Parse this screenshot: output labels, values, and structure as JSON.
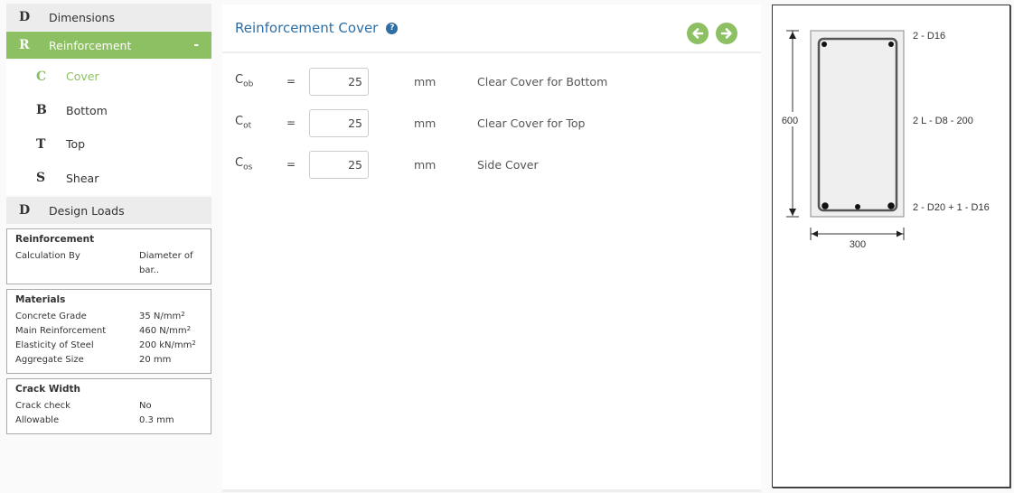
{
  "sidebar": {
    "sections": [
      {
        "letter": "D",
        "label": "Dimensions"
      },
      {
        "letter": "R",
        "label": "Reinforcement",
        "toggle": "-"
      },
      {
        "letter": "D",
        "label": "Design Loads"
      }
    ],
    "sub_items": [
      {
        "letter": "C",
        "label": "Cover"
      },
      {
        "letter": "B",
        "label": "Bottom"
      },
      {
        "letter": "T",
        "label": "Top"
      },
      {
        "letter": "S",
        "label": "Shear"
      }
    ]
  },
  "summary": {
    "reinforcement": {
      "title": "Reinforcement",
      "rows": [
        {
          "k": "Calculation By",
          "v": "Diameter of bar.."
        }
      ]
    },
    "materials": {
      "title": "Materials",
      "rows": [
        {
          "k": "Concrete Grade",
          "v": "35 N/mm",
          "sup": "2"
        },
        {
          "k": "Main Reinforcement",
          "v": "460 N/mm",
          "sup": "2"
        },
        {
          "k": "Elasticity of Steel",
          "v": "200 kN/mm",
          "sup": "2"
        },
        {
          "k": "Aggregate Size",
          "v": "20 mm"
        }
      ]
    },
    "crack": {
      "title": "Crack Width",
      "rows": [
        {
          "k": "Crack check",
          "v": "No"
        },
        {
          "k": "Allowable",
          "v": "0.3 mm"
        }
      ]
    }
  },
  "main": {
    "title": "Reinforcement Cover",
    "help_icon": "?",
    "fields": [
      {
        "sym": "C",
        "sub": "ob",
        "eq": "=",
        "value": "25",
        "unit": "mm",
        "desc": "Clear Cover for Bottom"
      },
      {
        "sym": "C",
        "sub": "ot",
        "eq": "=",
        "value": "25",
        "unit": "mm",
        "desc": "Clear Cover for Top"
      },
      {
        "sym": "C",
        "sub": "os",
        "eq": "=",
        "value": "25",
        "unit": "mm",
        "desc": "Side Cover"
      }
    ]
  },
  "diagram": {
    "height_label": "600",
    "width_label": "300",
    "top_bars": "2 - D16",
    "stirrups": "2 L - D8 - 200",
    "bottom_bars": "2 - D20 + 1 - D16"
  },
  "colors": {
    "accent": "#8cc063",
    "title": "#2d6fa5"
  }
}
